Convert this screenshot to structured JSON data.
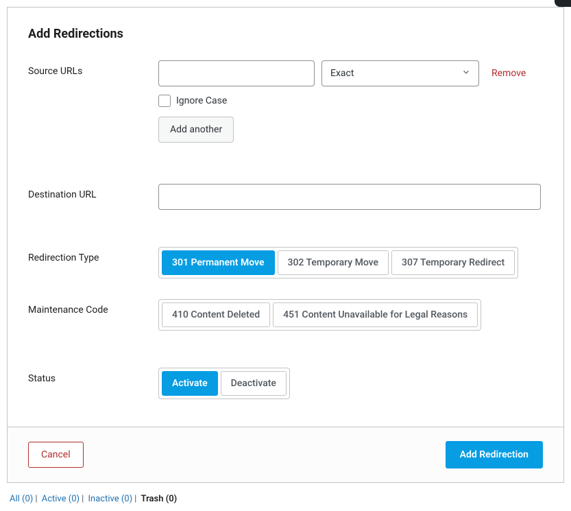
{
  "title": "Add Redirections",
  "labels": {
    "source_urls": "Source URLs",
    "destination_url": "Destination URL",
    "redirection_type": "Redirection Type",
    "maintenance_code": "Maintenance Code",
    "status": "Status"
  },
  "source": {
    "value": "",
    "match_type_selected": "Exact",
    "remove_label": "Remove",
    "ignore_case_label": "Ignore Case",
    "ignore_case_checked": false,
    "add_another_label": "Add another"
  },
  "destination": {
    "value": ""
  },
  "redirection_types": [
    {
      "label": "301 Permanent Move",
      "active": true
    },
    {
      "label": "302 Temporary Move",
      "active": false
    },
    {
      "label": "307 Temporary Redirect",
      "active": false
    }
  ],
  "maintenance_codes": [
    {
      "label": "410 Content Deleted",
      "active": false
    },
    {
      "label": "451 Content Unavailable for Legal Reasons",
      "active": false
    }
  ],
  "status_options": [
    {
      "label": "Activate",
      "active": true
    },
    {
      "label": "Deactivate",
      "active": false
    }
  ],
  "footer": {
    "cancel": "Cancel",
    "submit": "Add Redirection"
  },
  "filters": {
    "all": "All (0)",
    "active": "Active (0)",
    "inactive": "Inactive (0)",
    "trash": "Trash (0)"
  }
}
